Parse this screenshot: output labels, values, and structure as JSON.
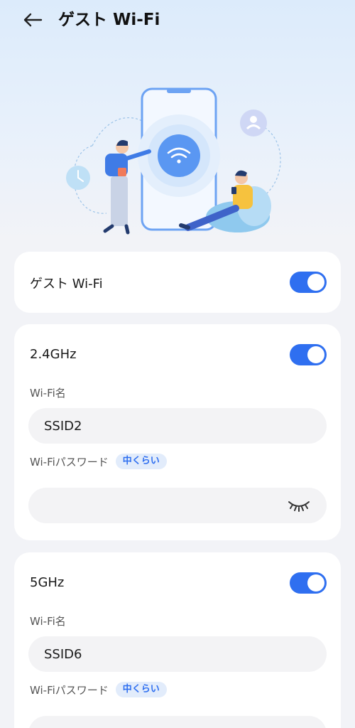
{
  "header": {
    "title": "ゲスト Wi-Fi",
    "back_icon": "arrow-left-icon"
  },
  "guest_wifi": {
    "label": "ゲスト Wi-Fi",
    "enabled": true
  },
  "band_24": {
    "label": "2.4GHz",
    "enabled": true,
    "name_label": "Wi-Fi名",
    "name_value": "SSID2",
    "password_label": "Wi-Fiパスワード",
    "strength_badge": "中くらい",
    "password_value": "",
    "eye_icon": "eye-closed-icon"
  },
  "band_5": {
    "label": "5GHz",
    "enabled": true,
    "name_label": "Wi-Fi名",
    "name_value": "SSID6",
    "password_label": "Wi-Fiパスワード",
    "strength_badge": "中くらい",
    "password_value": ""
  },
  "colors": {
    "accent": "#2f6ff0",
    "card": "#ffffff",
    "background": "#f2f3f7",
    "badge_bg": "#e2ecfb"
  }
}
